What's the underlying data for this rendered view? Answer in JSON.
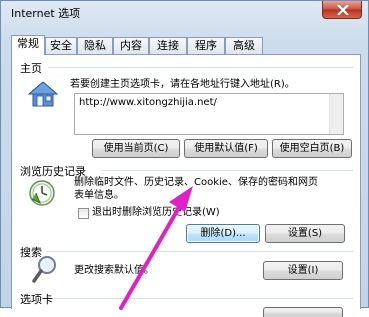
{
  "window": {
    "title": "Internet 选项"
  },
  "tabs": [
    {
      "label": "常规",
      "active": true
    },
    {
      "label": "安全",
      "active": false
    },
    {
      "label": "隐私",
      "active": false
    },
    {
      "label": "内容",
      "active": false
    },
    {
      "label": "连接",
      "active": false
    },
    {
      "label": "程序",
      "active": false
    },
    {
      "label": "高级",
      "active": false
    }
  ],
  "home": {
    "title": "主页",
    "description": "若要创建主页选项卡，请在各地址行键入地址(R)。",
    "url": "http://www.xitongzhijia.net/",
    "buttons": {
      "use_current": "使用当前页(C)",
      "use_default": "使用默认值(F)",
      "use_blank": "使用空白页(B)"
    }
  },
  "history": {
    "title": "浏览历史记录",
    "description_line1": "删除临时文件、历史记录、Cookie、保存的密码和网页",
    "description_line2": "表单信息。",
    "checkbox_label": "退出时删除浏览历史记录(W)",
    "checkbox_checked": false,
    "buttons": {
      "delete": "删除(D)...",
      "settings": "设置(S)"
    }
  },
  "search": {
    "title": "搜索",
    "description": "更改搜索默认值。",
    "buttons": {
      "settings": "设置(I)"
    }
  },
  "tabs_section": {
    "title": "选项卡"
  },
  "annotation": {
    "arrow_color": "#e020c8"
  },
  "icons": {
    "home": "home-icon",
    "history": "history-clock-icon",
    "search": "magnifier-icon",
    "close": "close-icon"
  }
}
